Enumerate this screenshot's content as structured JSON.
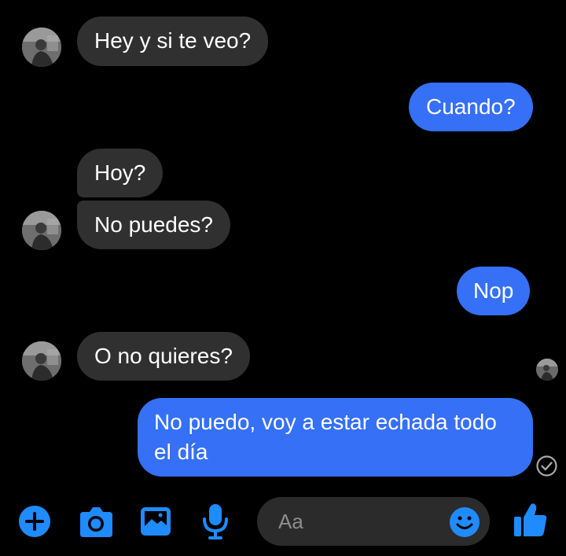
{
  "messages": [
    {
      "direction": "incoming",
      "text": "Hey y si te veo?"
    },
    {
      "direction": "outgoing",
      "text": "Cuando?"
    },
    {
      "direction": "incoming",
      "text": "Hoy?"
    },
    {
      "direction": "incoming",
      "text": "No puedes?"
    },
    {
      "direction": "outgoing",
      "text": "Nop"
    },
    {
      "direction": "incoming",
      "text": "O no quieres?"
    },
    {
      "direction": "outgoing",
      "text": "No puedo, voy a estar echada todo el día"
    }
  ],
  "composer": {
    "placeholder": "Aa",
    "icons": [
      "plus-icon",
      "camera-icon",
      "image-icon",
      "microphone-icon",
      "emoji-icon",
      "thumbs-up-icon"
    ]
  },
  "colors": {
    "background": "#000000",
    "incoming_bubble": "#303030",
    "outgoing_bubble": "#3570f6",
    "accent": "#1f8bff"
  }
}
